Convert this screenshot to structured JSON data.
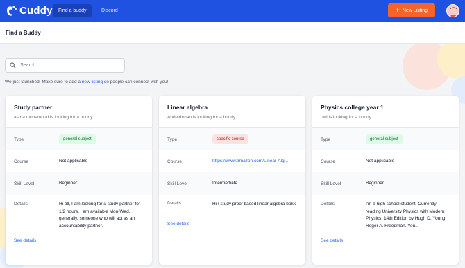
{
  "app": {
    "name": "Cuddy"
  },
  "nav": {
    "find_buddy": "Find a buddy",
    "discord": "Discord",
    "new_listing": "New Listing",
    "plus": "+"
  },
  "page": {
    "title": "Find a Buddy"
  },
  "search": {
    "placeholder": "Search"
  },
  "notice": {
    "before": "We just launched. Make sure to add a ",
    "link": "new listing",
    "after": " so people can connect with you!"
  },
  "labels": {
    "type": "Type",
    "course": "Course",
    "skill": "Skill Level",
    "details": "Details",
    "see_details": "See details"
  },
  "cards": [
    {
      "title": "Study partner",
      "subtitle": "asma mohamoud is looking for a buddy",
      "type": "general subject",
      "course": "Not applicable",
      "skill": "Beginner",
      "details": "Hi all, I am looking for a study partner for 1/2 hours. I am available Mon-Wed, generally, someone who will act as an accountability partner."
    },
    {
      "title": "Linear algebra",
      "subtitle": "Abdelrhman is looking for a buddy",
      "type": "specific course",
      "course": "https://www.amazon.com/Linear-Alg...",
      "skill": "Intermediate",
      "details": "Hi I study proof based linear algebra bokk"
    },
    {
      "title": "Physics college year 1",
      "subtitle": "owl is looking for a buddy",
      "type": "general subject",
      "course": "Not applicable",
      "skill": "Beginner",
      "details": "I'm a high school student. Currently reading University Physics with Modern Physics, 14th Edition by Hugh D. Young, Roger A. Freedman. You..."
    }
  ],
  "colors": {
    "topbar": "#1f52e0",
    "accent": "#f5652a",
    "link": "#2563eb"
  }
}
